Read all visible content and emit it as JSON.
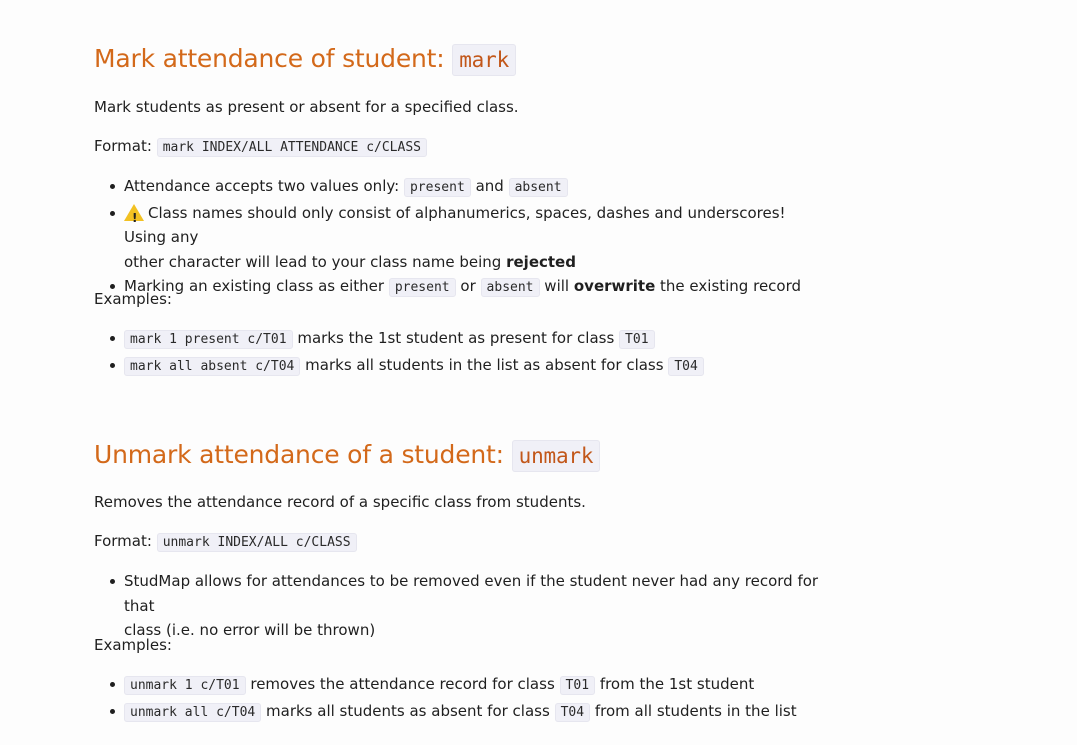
{
  "mark_section": {
    "title": "Mark attendance of student: ",
    "title_code": "mark",
    "description": "Mark students as present or absent for a specified class.",
    "format_label": "Format:",
    "format_code": "mark INDEX/ALL ATTENDANCE c/CLASS",
    "bullets": {
      "b1_text": "Attendance accepts two values only:",
      "b1_code1": "present",
      "b1_and": "and",
      "b1_code2": "absent",
      "b2_icon": "warning-icon",
      "b2_line1": "Class names should only consist of alphanumerics, spaces, dashes and underscores! Using any",
      "b2_line2": "other character will lead to your class name being",
      "b2_bold": "rejected",
      "b3_text": "Marking an existing class as either",
      "b3_code1": "present",
      "b3_or": "or",
      "b3_code2": "absent",
      "b3_will": "will",
      "b3_bold": "overwrite",
      "b3_rest": "the existing record"
    },
    "examples_label": "Examples:",
    "examples": [
      {
        "code": "mark 1 present c/T01",
        "text": "marks the 1st student as present for class",
        "class_code": "T01",
        "after": ""
      },
      {
        "code": "mark all absent c/T04",
        "text": "marks all students in the list as absent for class",
        "class_code": "T04",
        "after": ""
      }
    ]
  },
  "unmark_section": {
    "title": "Unmark attendance of a student: ",
    "title_code": "unmark",
    "description": "Removes the attendance record of a specific class from students.",
    "format_label": "Format:",
    "format_code": "unmark INDEX/ALL c/CLASS",
    "bullets": {
      "b1_line1": "StudMap allows for attendances to be removed even if the student never had any record for that",
      "b1_line2": "class (i.e. no error will be thrown)"
    },
    "examples_label": "Examples:",
    "examples": [
      {
        "code": "unmark 1 c/T01",
        "text": "removes the attendance record for class",
        "class_code": "T01",
        "after": "from the 1st student"
      },
      {
        "code": "unmark all c/T04",
        "text": "marks all students as absent for class",
        "class_code": "T04",
        "after": "from all students in the list"
      }
    ]
  },
  "colors": {
    "heading": "#d3691a",
    "code_bg": "#f0f0f7"
  }
}
